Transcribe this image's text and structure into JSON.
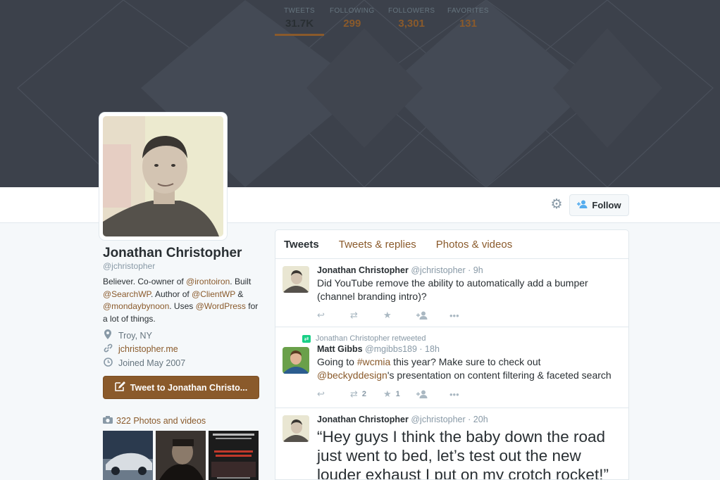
{
  "header": {
    "stats": [
      {
        "label": "TWEETS",
        "value": "31.7K"
      },
      {
        "label": "FOLLOWING",
        "value": "299"
      },
      {
        "label": "FOLLOWERS",
        "value": "3,301"
      },
      {
        "label": "FAVORITES",
        "value": "131"
      }
    ],
    "follow_label": "Follow"
  },
  "profile": {
    "name": "Jonathan Christopher",
    "handle": "@jchristopher",
    "bio": {
      "p1": "Believer. Co-owner of ",
      "m1": "@irontoiron",
      "p2": ". Built ",
      "m2": "@SearchWP",
      "p3": ". Author of ",
      "m3": "@ClientWP",
      "p4": " & ",
      "m4": "@mondaybynoon",
      "p5": ". Uses ",
      "m5": "@WordPress",
      "p6": " for a lot of things."
    },
    "location": "Troy, NY",
    "website": "jchristopher.me",
    "joined": "Joined May 2007",
    "tweet_to_label": "Tweet to Jonathan Christo...",
    "photos_label": "322 Photos and videos"
  },
  "timeline": {
    "tabs": [
      "Tweets",
      "Tweets & replies",
      "Photos & videos"
    ],
    "tweets": [
      {
        "name": "Jonathan Christopher",
        "handle": "@jchristopher",
        "time": "· 9h",
        "text": "Did YouTube remove the ability to automatically add a bumper (channel branding intro)?",
        "retweets": "",
        "favorites": ""
      },
      {
        "context": "Jonathan Christopher retweeted",
        "name": "Matt Gibbs",
        "handle": "@mgibbs189",
        "time": "· 18h",
        "text_parts": {
          "a": "Going to ",
          "b": "#wcmia",
          "c": " this year? Make sure to check out ",
          "d": "@beckyddesign",
          "e": "'s presentation on content filtering & faceted search"
        },
        "retweets": "2",
        "favorites": "1"
      },
      {
        "name": "Jonathan Christopher",
        "handle": "@jchristopher",
        "time": "· 20h",
        "text": "“Hey guys I think the baby down the road just went to bed, let’s test out the new louder exhaust I put on my crotch rocket!”"
      }
    ]
  },
  "colors": {
    "accent": "#8a5a2b",
    "banner": "#3c414b"
  },
  "icons": [
    "gear-icon",
    "follow-user-icon",
    "location-icon",
    "link-icon",
    "calendar-icon",
    "compose-icon",
    "camera-icon",
    "reply-icon",
    "retweet-icon",
    "favorite-icon",
    "follow-icon",
    "more-icon"
  ]
}
